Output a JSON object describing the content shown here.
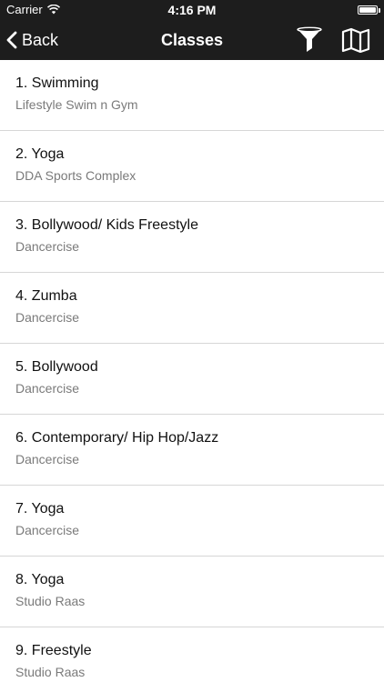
{
  "status_bar": {
    "carrier": "Carrier",
    "time": "4:16 PM",
    "battery_level": 1.0
  },
  "nav": {
    "back_label": "Back",
    "title": "Classes",
    "filter_icon": "filter-funnel-icon",
    "map_icon": "map-icon"
  },
  "classes": [
    {
      "title": "1. Swimming",
      "venue": "Lifestyle Swim n Gym"
    },
    {
      "title": "2. Yoga",
      "venue": "DDA Sports Complex"
    },
    {
      "title": "3. Bollywood/ Kids Freestyle",
      "venue": "Dancercise"
    },
    {
      "title": "4. Zumba",
      "venue": "Dancercise"
    },
    {
      "title": "5. Bollywood",
      "venue": "Dancercise"
    },
    {
      "title": "6. Contemporary/ Hip Hop/Jazz",
      "venue": "Dancercise"
    },
    {
      "title": "7. Yoga",
      "venue": "Dancercise"
    },
    {
      "title": "8. Yoga",
      "venue": "Studio Raas"
    },
    {
      "title": "9. Freestyle",
      "venue": "Studio Raas"
    }
  ],
  "colors": {
    "bar_background": "#1d1d1d",
    "title_text": "#111111",
    "subtitle_text": "#7a7a7a",
    "separator": "#d6d6d6"
  }
}
